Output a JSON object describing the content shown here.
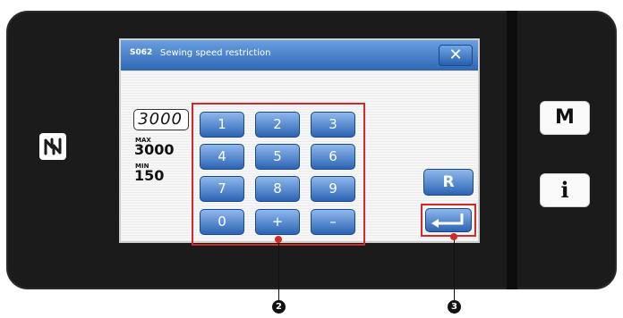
{
  "dialog": {
    "code": "S062",
    "title": "Sewing speed restriction",
    "close_symbol": "✕"
  },
  "value": {
    "current": "3000",
    "max_label": "MAX",
    "max_value": "3000",
    "min_label": "MIN",
    "min_value": "150"
  },
  "keypad": {
    "keys": [
      "1",
      "2",
      "3",
      "4",
      "5",
      "6",
      "7",
      "8",
      "9",
      "0",
      "+",
      "–"
    ]
  },
  "buttons": {
    "reset_label": "R",
    "menu_label": "M",
    "info_label": "i",
    "enter_icon": "enter-icon"
  },
  "icons": {
    "nfc": "nfc-icon"
  },
  "callouts": {
    "keypad_marker": "2",
    "enter_marker": "3"
  },
  "colors": {
    "button_blue": "#2c64b4",
    "titlebar_blue": "#2f66b3",
    "highlight_red": "#d12a2a",
    "bezel": "#1b1b1b"
  }
}
